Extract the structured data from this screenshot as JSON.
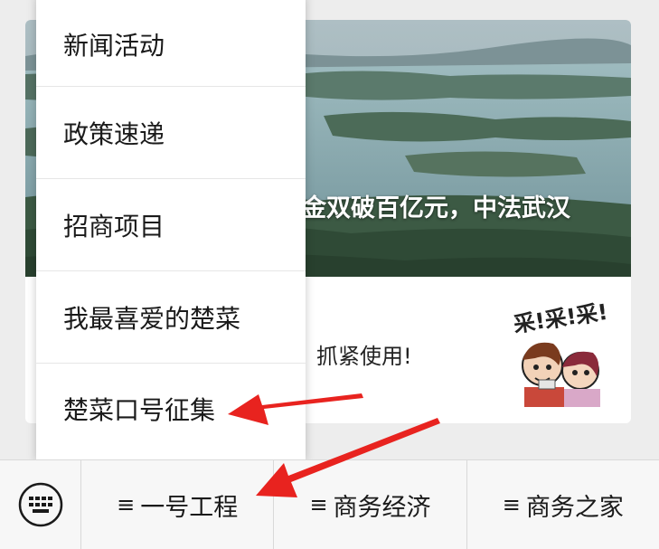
{
  "popup_menu": {
    "items": [
      {
        "label": "新闻活动"
      },
      {
        "label": "政策速递"
      },
      {
        "label": "招商项目"
      },
      {
        "label": "我最喜爱的楚菜"
      },
      {
        "label": "楚菜口号征集"
      }
    ]
  },
  "article": {
    "hero_title": "金双破百亿元，中法武汉",
    "promo_text": "抓紧使用!",
    "sticker_text": "采!采!采!"
  },
  "bottom_menu": {
    "keyboard_icon": "keyboard-icon",
    "items": [
      {
        "mark": "≡",
        "label": "一号工程"
      },
      {
        "mark": "≡",
        "label": "商务经济"
      },
      {
        "mark": "≡",
        "label": "商务之家"
      }
    ]
  },
  "colors": {
    "arrow": "#e8231f",
    "background": "#ededed",
    "menu_text": "#1a1a1a"
  }
}
